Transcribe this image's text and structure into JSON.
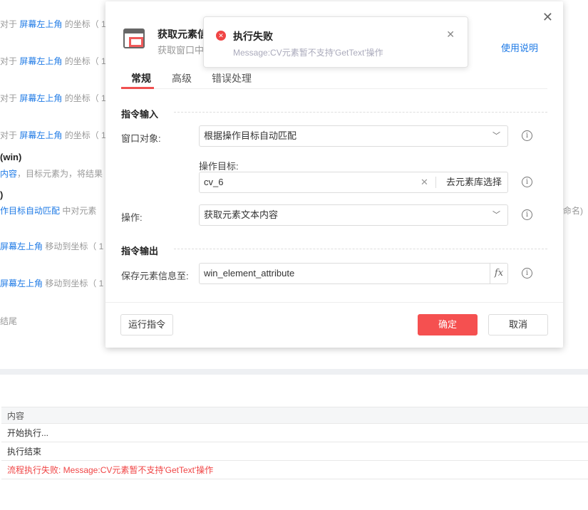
{
  "background": {
    "lines": [
      {
        "pre": "对于 ",
        "link": "屏幕左上角",
        "post": " 的坐标（ 1"
      },
      {
        "pre": "对于 ",
        "link": "屏幕左上角",
        "post": " 的坐标（ 1"
      },
      {
        "pre": "对于 ",
        "link": "屏幕左上角",
        "post": " 的坐标（ 1"
      },
      {
        "pre": "对于 ",
        "link": "屏幕左上角",
        "post": " 的坐标（ 1"
      }
    ],
    "win_title": "(win)",
    "win_desc_link": "内容",
    "win_desc_rest": "，目标元素为，将结果",
    "paren": ")",
    "match_link": "作目标自动匹配",
    "match_rest": " 中对元素",
    "right_fragment": "命名)",
    "move_lines": [
      {
        "link": "屏幕左上角",
        "post": " 移动到坐标（ 1"
      },
      {
        "link": "屏幕左上角",
        "post": " 移动到坐标（ 1"
      }
    ],
    "end": "结尾"
  },
  "log": {
    "header": "内容",
    "rows": [
      "开始执行...",
      "执行结束",
      "流程执行失败: Message:CV元素暂不支持'GetText'操作"
    ]
  },
  "dialog": {
    "title": "获取元素信",
    "subtitle": "获取窗口中",
    "help": "使用说明",
    "tabs": [
      "常规",
      "高级",
      "错误处理"
    ],
    "input_section": "指令输入",
    "output_section": "指令输出",
    "window_label": "窗口对象:",
    "window_value": "根据操作目标自动匹配",
    "target_label": "操作目标:",
    "target_value": "cv_6",
    "target_lib_btn": "去元素库选择",
    "op_label": "操作:",
    "op_value": "获取元素文本内容",
    "save_label": "保存元素信息至:",
    "save_value": "win_element_attribute",
    "run_btn": "运行指令",
    "ok_btn": "确定",
    "cancel_btn": "取消"
  },
  "toast": {
    "title": "执行失败",
    "message": "Message:CV元素暂不支持'GetText'操作"
  }
}
